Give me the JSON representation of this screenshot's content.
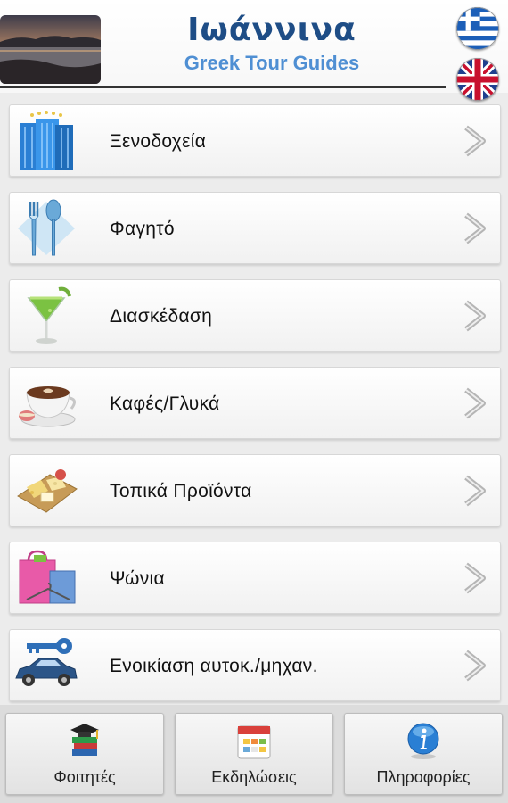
{
  "header": {
    "title": "Ιωάννινα",
    "subtitle": "Greek Tour Guides",
    "title_color": "#1e4d86",
    "subtitle_color": "#4f8fd3"
  },
  "languages": [
    {
      "code": "el",
      "icon": "greek-flag-icon"
    },
    {
      "code": "en",
      "icon": "uk-flag-icon"
    }
  ],
  "menu": {
    "items": [
      {
        "label": "Ξενοδοχεία",
        "icon": "hotel-building-icon"
      },
      {
        "label": "Φαγητό",
        "icon": "fork-spoon-icon"
      },
      {
        "label": "Διασκέδαση",
        "icon": "cocktail-glass-icon"
      },
      {
        "label": "Καφές/Γλυκά",
        "icon": "coffee-cup-icon"
      },
      {
        "label": "Τοπικά Προϊόντα",
        "icon": "cheese-board-icon"
      },
      {
        "label": "Ψώνια",
        "icon": "shopping-bag-icon"
      },
      {
        "label": "Ενοικίαση αυτοκ./μηχαν.",
        "icon": "car-key-icon"
      }
    ]
  },
  "tabs": [
    {
      "label": "Φοιτητές",
      "icon": "books-graduation-cap-icon"
    },
    {
      "label": "Εκδηλώσεις",
      "icon": "calendar-icon"
    },
    {
      "label": "Πληροφορίες",
      "icon": "info-icon"
    }
  ]
}
